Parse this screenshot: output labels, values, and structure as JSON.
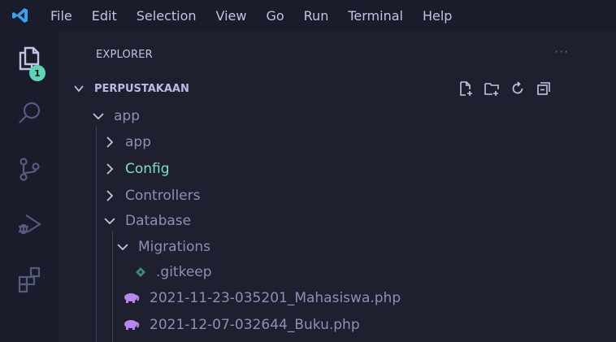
{
  "menubar": {
    "items": [
      "File",
      "Edit",
      "Selection",
      "View",
      "Go",
      "Run",
      "Terminal",
      "Help"
    ]
  },
  "activity": {
    "explorer_badge": "1",
    "icons": [
      "files-icon",
      "search-icon",
      "source-control-icon",
      "run-debug-icon",
      "extensions-icon"
    ]
  },
  "explorer": {
    "title": "EXPLORER",
    "more": "···",
    "workspace": "PERPUSTAKAAN"
  },
  "tree": {
    "app_root": "app",
    "app_sub": "app",
    "config": "Config",
    "controllers": "Controllers",
    "database": "Database",
    "migrations": "Migrations",
    "gitkeep": ".gitkeep",
    "file1": "2021-11-23-035201_Mahasiswa.php",
    "file2": "2021-12-07-032644_Buku.php"
  },
  "colors": {
    "background": "#1e2030",
    "config_highlight": "#7ee0c4",
    "php_icon": "#b689f0",
    "git_icon": "#3d8a72"
  }
}
